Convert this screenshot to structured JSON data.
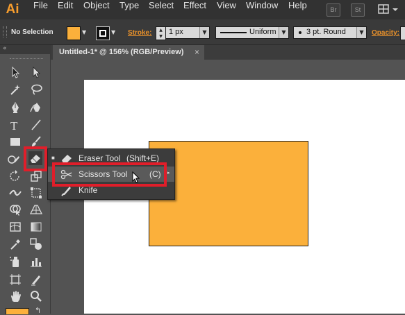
{
  "app": {
    "logo": "Ai"
  },
  "menu": [
    "File",
    "Edit",
    "Object",
    "Type",
    "Select",
    "Effect",
    "View",
    "Window",
    "Help"
  ],
  "menu_buttons": {
    "bridge": "Br",
    "stock": "St"
  },
  "control_bar": {
    "selection": "No Selection",
    "fill_color": "#fbb03b",
    "stroke_label": "Stroke:",
    "stroke_weight": "1 px",
    "profile": "Uniform",
    "brush": "3 pt. Round",
    "opacity_label": "Opacity:"
  },
  "document": {
    "tab_title": "Untitled-1* @ 156% (RGB/Preview)",
    "close_glyph": "×"
  },
  "flyout": {
    "items": [
      {
        "label": "Eraser Tool",
        "shortcut": "(Shift+E)",
        "icon": "eraser-icon"
      },
      {
        "label": "Scissors Tool",
        "shortcut": "(C)",
        "icon": "scissors-icon"
      },
      {
        "label": "Knife",
        "shortcut": "",
        "icon": "knife-icon"
      }
    ]
  },
  "colors": {
    "accent_orange": "#e8912b",
    "highlight_red": "#e01e2a",
    "shape_fill": "#fbb03b"
  }
}
